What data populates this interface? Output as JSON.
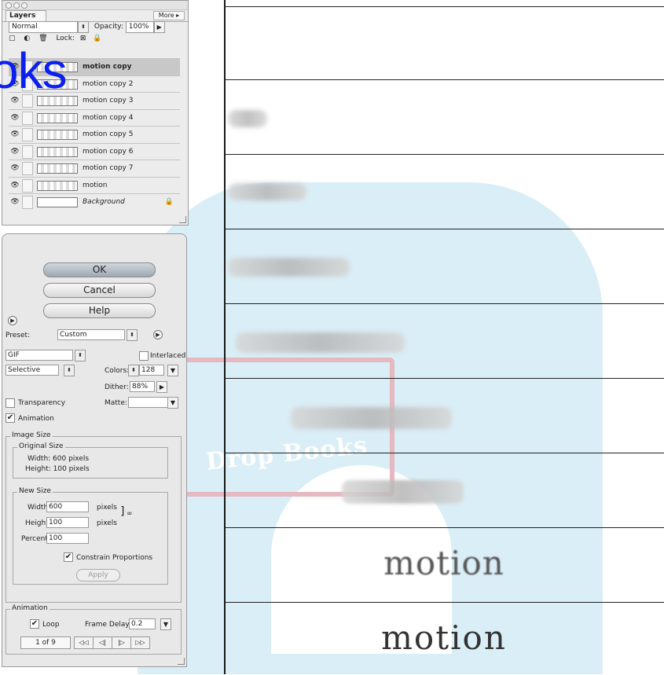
{
  "watermark": {
    "brand": "Drop Books",
    "overlay": "oks"
  },
  "frames": [
    "motion",
    "motion"
  ],
  "layers_panel": {
    "tab": "Layers",
    "more": "More ▸",
    "blend_mode": "Normal",
    "opacity_label": "Opacity:",
    "opacity_value": "100%",
    "lock_label": "Lock:",
    "layers": [
      {
        "name": "motion copy",
        "selected": true
      },
      {
        "name": "motion copy 2"
      },
      {
        "name": "motion copy 3"
      },
      {
        "name": "motion copy 4"
      },
      {
        "name": "motion copy 5"
      },
      {
        "name": "motion copy 6"
      },
      {
        "name": "motion copy 7"
      },
      {
        "name": "motion"
      },
      {
        "name": "Background",
        "locked": true
      }
    ]
  },
  "save_panel": {
    "ok": "OK",
    "cancel": "Cancel",
    "help": "Help",
    "preset_label": "Preset:",
    "preset_value": "Custom",
    "format": "GIF",
    "interlaced": "Interlaced",
    "reduction": "Selective",
    "colors_label": "Colors:",
    "colors_value": "128",
    "dither_label": "Dither:",
    "dither_value": "88%",
    "transparency": "Transparency",
    "matte_label": "Matte:",
    "animation_check": "Animation",
    "image_size": "Image Size",
    "original_size": "Original Size",
    "orig_width": "Width: 600 pixels",
    "orig_height": "Height: 100 pixels",
    "new_size": "New Size",
    "width_label": "Width:",
    "width_value": "600",
    "height_label": "Height:",
    "height_value": "100",
    "pixels": "pixels",
    "percent_label": "Percent:",
    "percent_value": "100",
    "constrain": "Constrain Proportions",
    "apply": "Apply",
    "animation_section": "Animation",
    "loop": "Loop",
    "frame_delay_label": "Frame Delay:",
    "frame_delay_value": "0.2",
    "frame_counter": "1 of 9",
    "nav": [
      "◁◁",
      "◁|",
      "|▷",
      "▷▷"
    ]
  }
}
